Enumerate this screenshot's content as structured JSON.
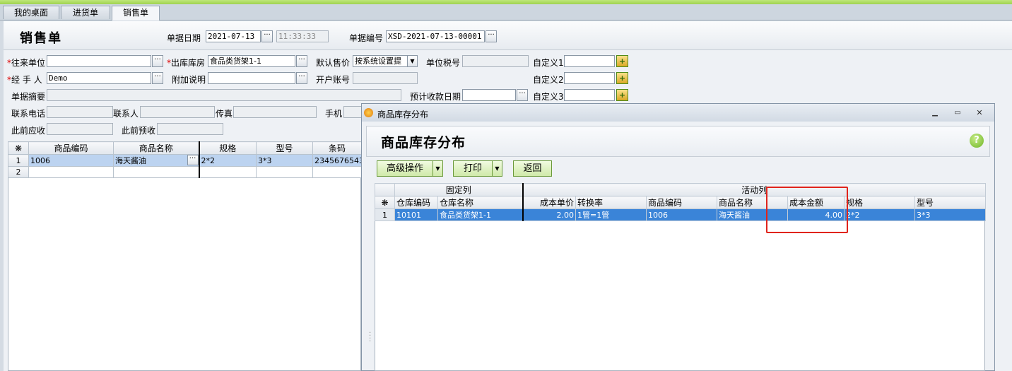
{
  "tabs": [
    "我的桌面",
    "进货单",
    "销售单"
  ],
  "form": {
    "title": "销售单",
    "date_label": "单据日期",
    "date_value": "2021-07-13",
    "time_value": "11:33:33",
    "docno_label": "单据编号",
    "docno_value": "XSD-2021-07-13-00001",
    "partner_label": "往来单位",
    "partner_value": "",
    "warehouse_label": "出库库房",
    "warehouse_value": "食品类货架1-1",
    "price_label": "默认售价",
    "price_value": "按系统设置提",
    "taxno_label": "单位税号",
    "custom1_label": "自定义1",
    "handler_label": "经 手 人",
    "handler_value": "Demo",
    "note_label": "附加说明",
    "bank_label": "开户账号",
    "custom2_label": "自定义2",
    "summary_label": "单据摘要",
    "due_label": "预计收款日期",
    "custom3_label": "自定义3",
    "phone_label": "联系电话",
    "contact_label": "联系人",
    "fax_label": "传真",
    "mobile_label": "手机",
    "prev_recv_label": "此前应收",
    "prev_adv_label": "此前预收"
  },
  "main_grid": {
    "corner": "❋",
    "columns": [
      "商品编码",
      "商品名称",
      "规格",
      "型号",
      "条码"
    ],
    "rows": [
      {
        "no": "1",
        "code": "1006",
        "name": "海天酱油",
        "spec": "2*2",
        "model": "3*3",
        "barcode": "2345676543"
      },
      {
        "no": "2",
        "code": "",
        "name": "",
        "spec": "",
        "model": "",
        "barcode": ""
      }
    ]
  },
  "dialog": {
    "window_title": "商品库存分布",
    "heading": "商品库存分布",
    "buttons": {
      "advanced": "高级操作",
      "print": "打印",
      "back": "返回"
    },
    "group_fixed": "固定列",
    "group_active": "活动列",
    "corner": "❋",
    "columns": [
      "仓库编码",
      "仓库名称",
      "成本单价",
      "转换率",
      "商品编码",
      "商品名称",
      "成本金额",
      "规格",
      "型号"
    ],
    "rows": [
      {
        "no": "1",
        "wh_code": "10101",
        "wh_name": "食品类货架1-1",
        "unit_cost": "2.00",
        "rate": "1管=1管",
        "goods_code": "1006",
        "goods_name": "海天酱油",
        "amount": "4.00",
        "spec": "2*2",
        "model": "3*3"
      }
    ]
  },
  "colors": {
    "accent_green": "#9fd24f",
    "selection_blue": "#3a84d8",
    "highlight_red": "#e0241b"
  }
}
